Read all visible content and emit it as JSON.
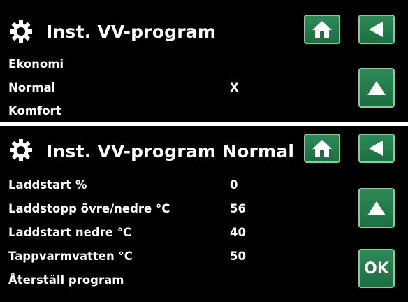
{
  "screen1": {
    "title": "Inst. VV-program",
    "icons": {
      "settings": "gear-icon",
      "home": "home-icon",
      "back": "back-arrow-icon",
      "up": "up-arrow-icon"
    },
    "options": [
      {
        "label": "Ekonomi",
        "marker": ""
      },
      {
        "label": "Normal",
        "marker": "X"
      },
      {
        "label": "Komfort",
        "marker": ""
      }
    ]
  },
  "screen2": {
    "title": "Inst. VV-program Normal",
    "icons": {
      "settings": "gear-icon",
      "home": "home-icon",
      "back": "back-arrow-icon",
      "up": "up-arrow-icon"
    },
    "rows": [
      {
        "label": "Laddstart %",
        "value": "0"
      },
      {
        "label": "Laddstopp övre/nedre °C",
        "value": "56"
      },
      {
        "label": "Laddstart nedre °C",
        "value": "40"
      },
      {
        "label": "Tappvarmvatten °C",
        "value": "50"
      },
      {
        "label": "Återställ program",
        "value": ""
      }
    ],
    "ok_label": "OK"
  },
  "colors": {
    "panel_bg": "#000000",
    "button_green": "#1d7a48",
    "button_border": "#7fcf9e",
    "text": "#ffffff"
  }
}
